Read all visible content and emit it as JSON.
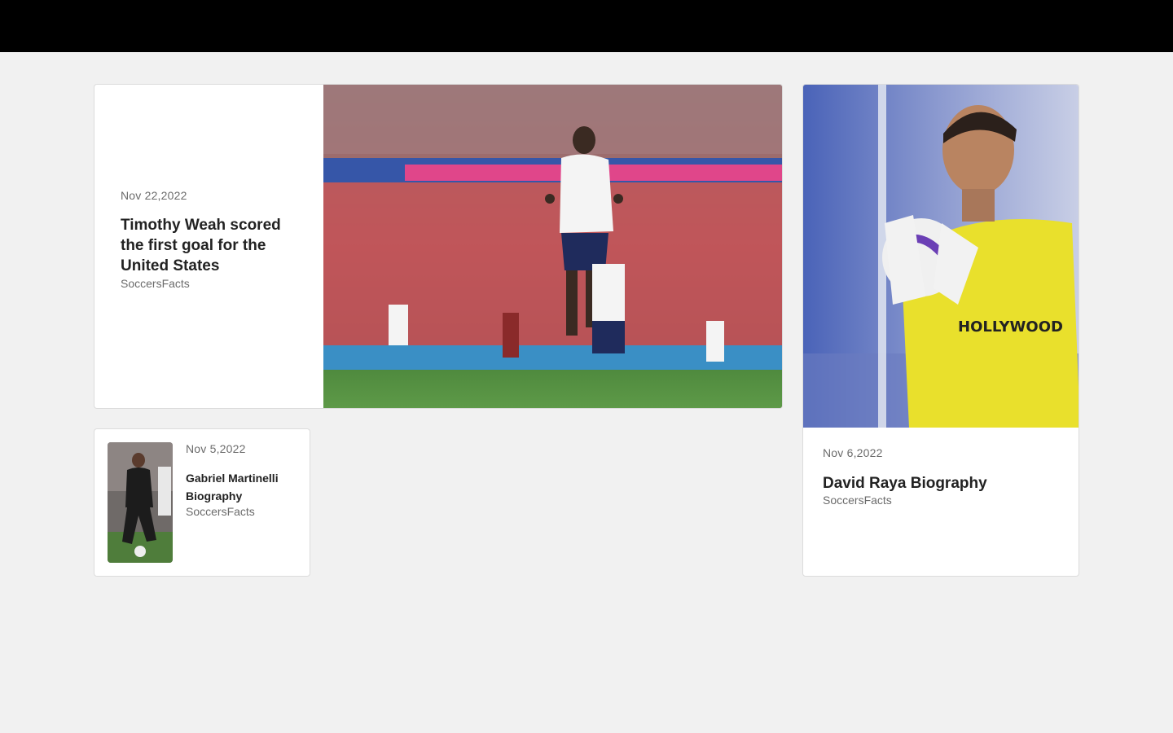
{
  "articles": [
    {
      "date": "Nov 22,2022",
      "title": "Timothy Weah scored the first goal for the United States",
      "source": "SoccersFacts",
      "image": "soccer-player-jumping-photo"
    },
    {
      "date": "Nov 5,2022",
      "title": "Gabriel Martinelli Biography",
      "source": "SoccersFacts",
      "image": "soccer-player-dribbling-photo"
    },
    {
      "date": "Nov 6,2022",
      "title": "David Raya Biography",
      "source": "SoccersFacts",
      "image": "goalkeeper-holding-ball-photo"
    }
  ],
  "colors": {
    "topbar": "#000000",
    "background": "#f1f1f1",
    "card": "#ffffff"
  }
}
